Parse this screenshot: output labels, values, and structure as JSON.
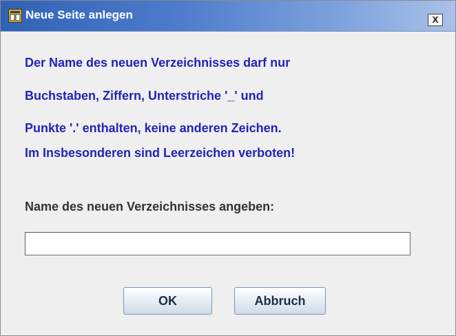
{
  "window": {
    "title": "Neue Seite anlegen",
    "close_label": "X"
  },
  "message": {
    "lines": [
      "Der Name des neuen Verzeichnisses darf nur",
      "Buchstaben, Ziffern, Unterstriche '_' und",
      "Punkte '.' enthalten, keine anderen Zeichen.",
      "Im Insbesonderen sind Leerzeichen verboten!"
    ],
    "color": "#2323b8"
  },
  "form": {
    "label": "Name des neuen Verzeichnisses angeben:",
    "input_value": ""
  },
  "buttons": {
    "ok": "OK",
    "cancel": "Abbruch"
  },
  "colors": {
    "titlebar_start": "#2f62b4",
    "titlebar_end": "#a9c1ea",
    "dialog_background": "#efefef"
  }
}
